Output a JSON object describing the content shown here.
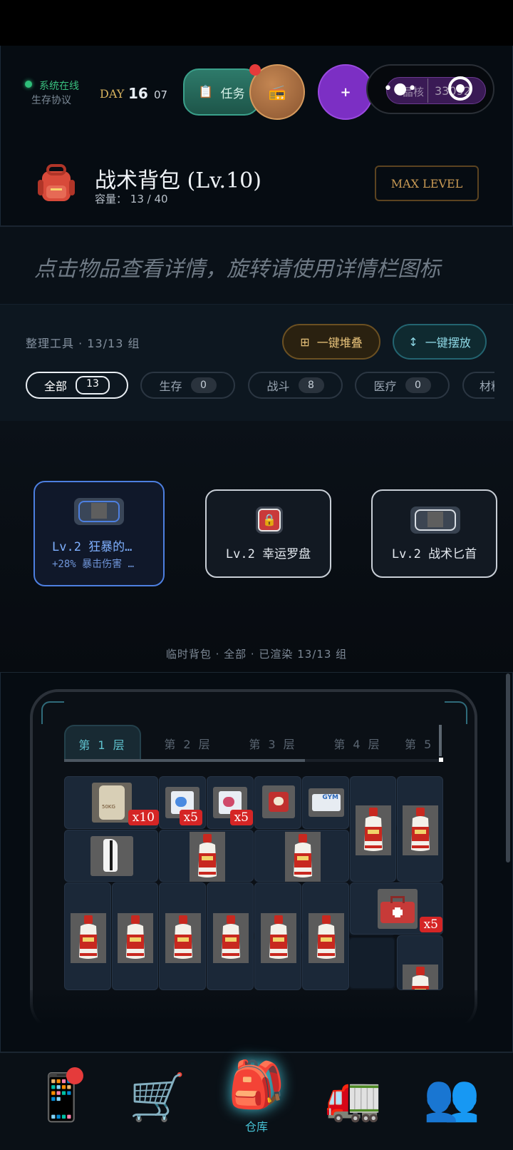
{
  "header": {
    "status_online": "系统在线",
    "status_protocol": "生存协议",
    "day_label": "DAY",
    "day_number": "16",
    "day_hour": "07",
    "task_label": "任务",
    "crystal_label": "晶核",
    "crystal_value": "33092"
  },
  "bag": {
    "title": "战术背包 (Lv.10)",
    "capacity_label": "容量：",
    "capacity_used": "13",
    "capacity_sep": "/",
    "capacity_max": "40",
    "max_level_label": "MAX LEVEL"
  },
  "hint": "点击物品查看详情，旋转请使用详情栏图标",
  "tools": {
    "label": "整理工具 · 13/13 组",
    "stack_label": "一键堆叠",
    "place_label": "一键摆放"
  },
  "filters": [
    {
      "label": "全部",
      "count": "13"
    },
    {
      "label": "生存",
      "count": "0"
    },
    {
      "label": "战斗",
      "count": "8"
    },
    {
      "label": "医疗",
      "count": "0"
    },
    {
      "label": "材料",
      "count": ""
    }
  ],
  "equipment": [
    {
      "title": "Lv.2 狂暴的…",
      "subtitle": "+28% 暴击伤害 …"
    },
    {
      "title": "Lv.2 幸运罗盘",
      "subtitle": ""
    },
    {
      "title": "Lv.2 战术匕首",
      "subtitle": ""
    }
  ],
  "temp_bag_label": "临时背包 · 全部 · 已渲染 13/13 组",
  "layers": [
    "第 1 层",
    "第 2 层",
    "第 3 层",
    "第 4 层",
    "第 5"
  ],
  "items": {
    "food_qty": "x10",
    "card_a_qty": "x5",
    "card_b_qty": "x5",
    "gym_label": "GYM",
    "medkit_qty": "x5",
    "bottle_label": "茅台",
    "food_label": "50KG"
  },
  "nav": {
    "warehouse_label": "仓库"
  },
  "colors": {
    "accent_teal": "#47c3d6",
    "alert_red": "#e53b3b",
    "gold": "#c99a54",
    "selected_blue": "#4d7fe0"
  },
  "icons": [
    "phone-icon",
    "cart-icon",
    "backpack-icon",
    "truck-icon",
    "people-icon"
  ]
}
